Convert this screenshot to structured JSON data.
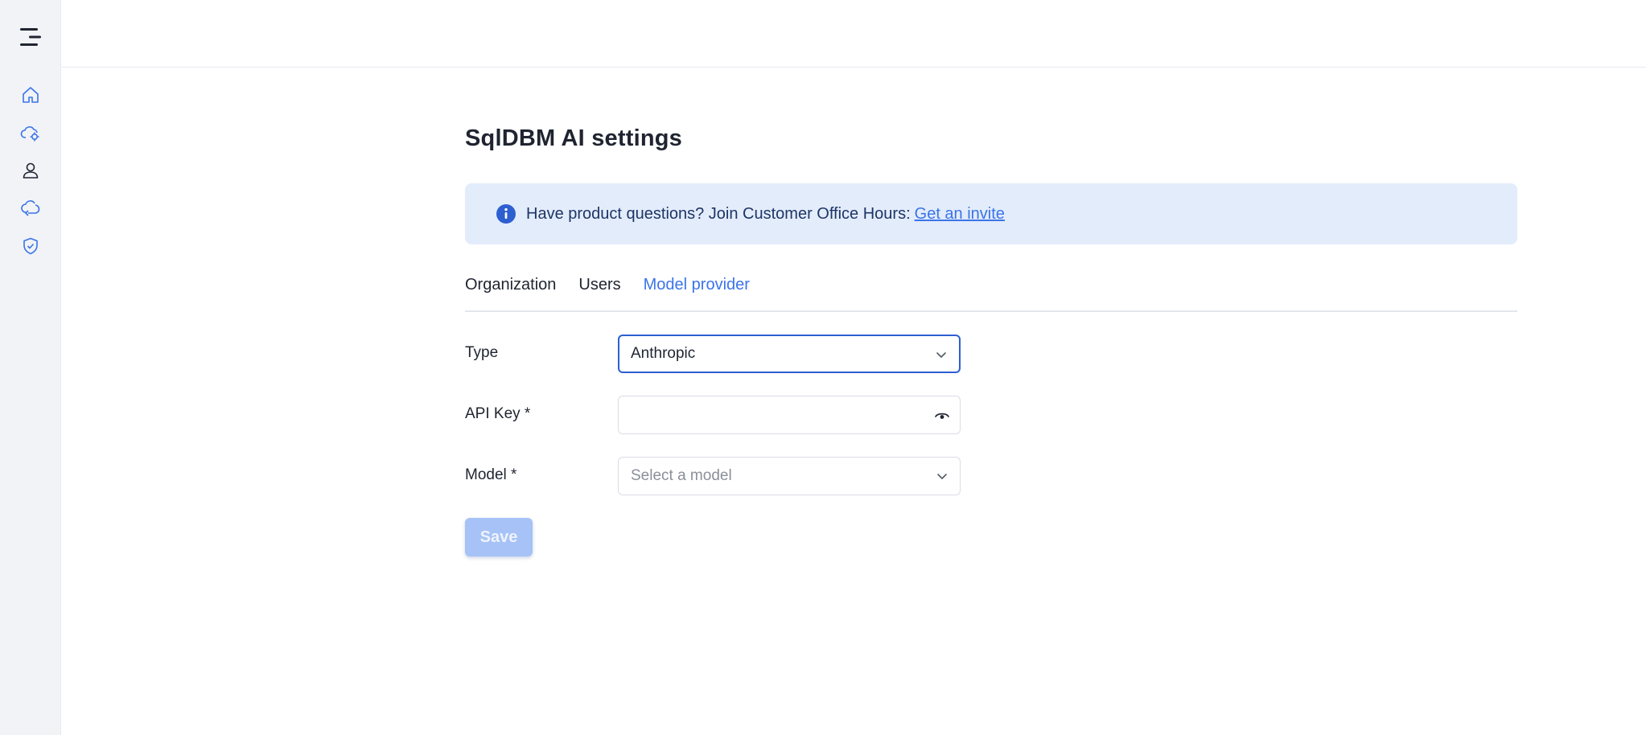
{
  "sidebar": {
    "menu_icon": "menu-icon",
    "items": [
      {
        "icon": "home-icon",
        "name": "home"
      },
      {
        "icon": "cloud-settings-icon",
        "name": "cloud"
      },
      {
        "icon": "user-icon",
        "name": "user"
      },
      {
        "icon": "puzzle-icon",
        "name": "integrations"
      },
      {
        "icon": "shield-check-icon",
        "name": "security"
      }
    ]
  },
  "page": {
    "title": "SqlDBM AI settings"
  },
  "banner": {
    "text": "Have product questions? Join Customer Office Hours:",
    "link_label": "Get an invite",
    "icon": "info-icon"
  },
  "tabs": [
    {
      "label": "Organization",
      "active": false
    },
    {
      "label": "Users",
      "active": false
    },
    {
      "label": "Model provider",
      "active": true
    }
  ],
  "form": {
    "type_label": "Type",
    "type_value": "Anthropic",
    "api_key_label": "API Key *",
    "api_key_value": "",
    "model_label": "Model *",
    "model_placeholder": "Select a model",
    "save_label": "Save"
  },
  "colors": {
    "accent": "#3b74e8",
    "banner_bg": "#e3ecfb",
    "sidebar_bg": "#f1f3f7",
    "save_disabled": "#a7c2f6"
  }
}
